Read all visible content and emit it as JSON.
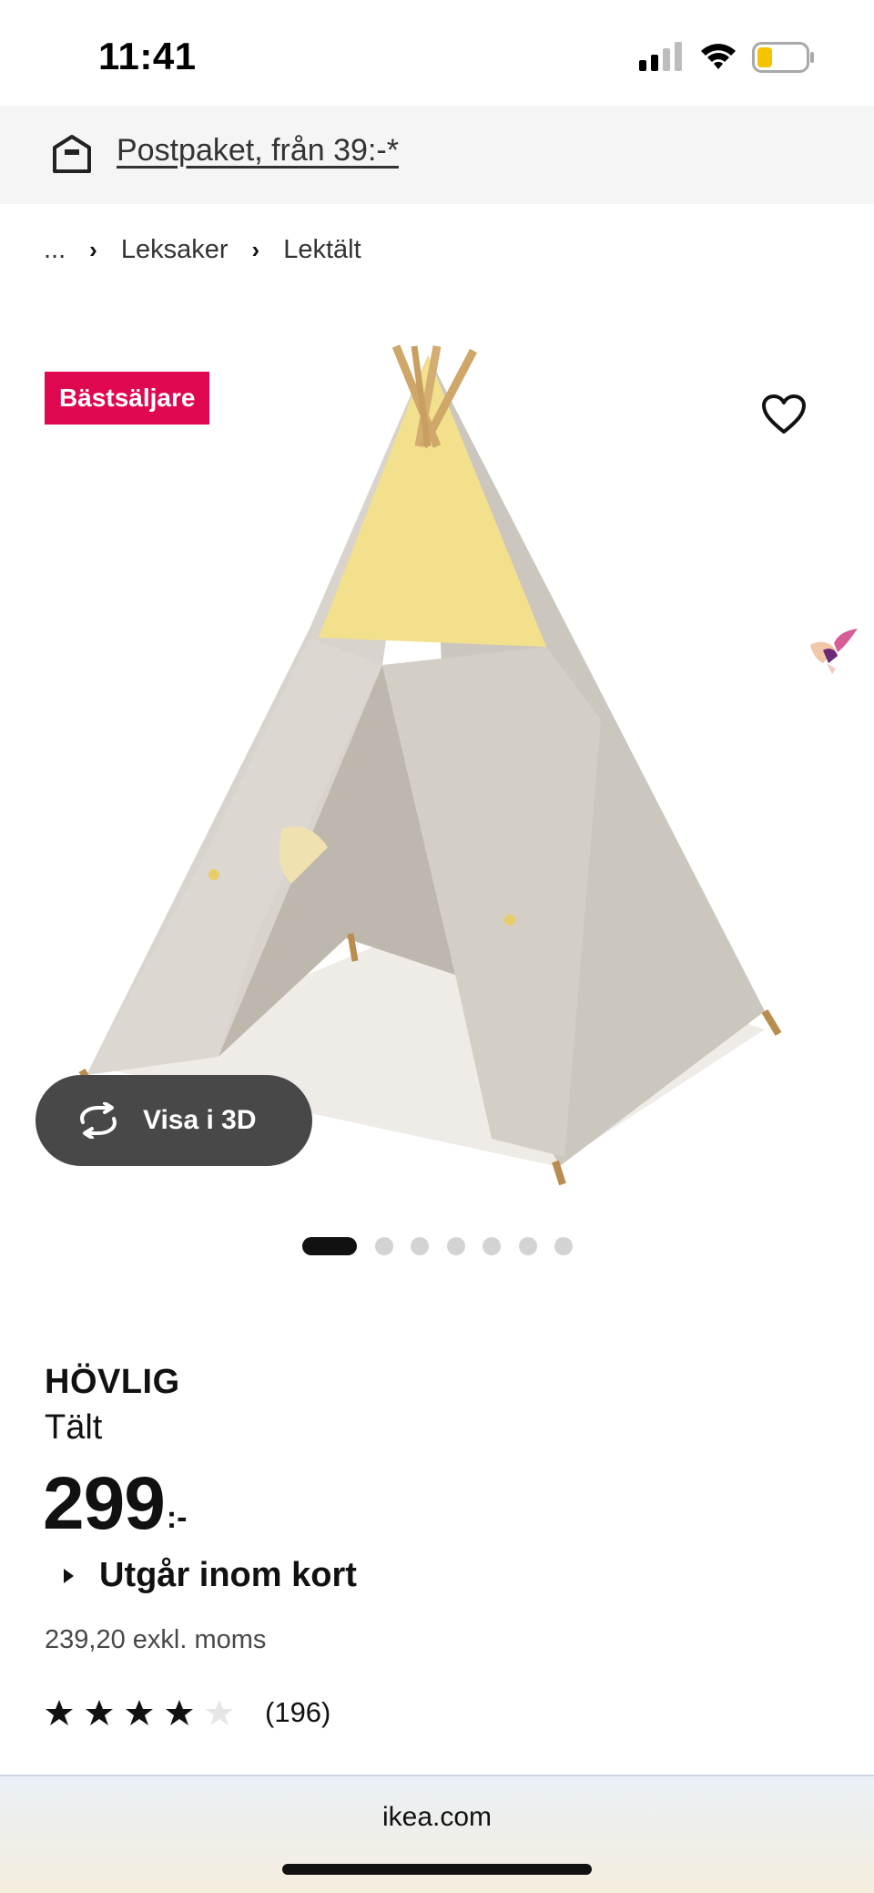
{
  "status_bar": {
    "time": "11:41"
  },
  "promo": {
    "label": "Postpaket, från 39:-*"
  },
  "breadcrumb": {
    "items": [
      "...",
      "Leksaker",
      "Lektält"
    ]
  },
  "product": {
    "badge": "Bästsäljare",
    "view_3d_label": "Visa i 3D",
    "carousel": {
      "total": 7,
      "active_index": 0
    },
    "name": "HÖVLIG",
    "type": "Tält",
    "price_integer": "299",
    "price_suffix": ":-",
    "availability": "Utgår inom kort",
    "price_ex_vat": "239,20 exkl. moms",
    "rating": {
      "stars": 4,
      "max": 5,
      "count_label": "(196)"
    }
  },
  "browser": {
    "url": "ikea.com"
  },
  "colors": {
    "badge": "#e00751",
    "pill": "#484848",
    "promo_bg": "#f5f5f5",
    "tent_yellow": "#f1df8a",
    "tent_grey": "#d0cbc3"
  }
}
